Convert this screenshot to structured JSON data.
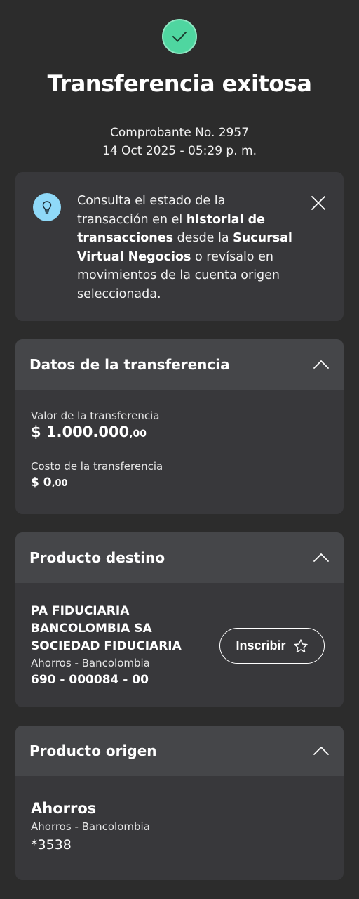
{
  "header": {
    "title": "Transferencia exitosa",
    "receipt_line": "Comprobante No. 2957",
    "datetime": "14 Oct 2025 - 05:29 p. m."
  },
  "info": {
    "t1": "Consulta el estado de la transacción en el ",
    "b1": "historial de transacciones",
    "t2": " desde la ",
    "b2": "Sucursal Virtual Negocios",
    "t3": " o revísalo en movimientos de la cuenta origen seleccionada."
  },
  "transfer": {
    "title": "Datos de la transferencia",
    "value_label": "Valor de la transferencia",
    "value_int": "$ 1.000.000",
    "value_dec": ",00",
    "cost_label": "Costo de la transferencia",
    "cost_int": "$ 0",
    "cost_dec": ",00"
  },
  "destination": {
    "title": "Producto destino",
    "name": "PA FIDUCIARIA BANCOLOMBIA SA SOCIEDAD FIDUCIARIA",
    "type": "Ahorros - Bancolombia",
    "account": "690 - 000084 - 00",
    "enroll_label": "Inscribir"
  },
  "origin": {
    "title": "Producto origen",
    "name": "Ahorros",
    "type": "Ahorros - Bancolombia",
    "account": "*3538"
  },
  "colors": {
    "background": "#2c2c2c",
    "card": "#38383b",
    "card_header": "#454649",
    "success": "#4fd6a0",
    "info_icon": "#8fd9f8"
  },
  "icons": [
    "check-icon",
    "lightbulb-icon",
    "close-icon",
    "chevron-up-icon",
    "star-icon"
  ]
}
